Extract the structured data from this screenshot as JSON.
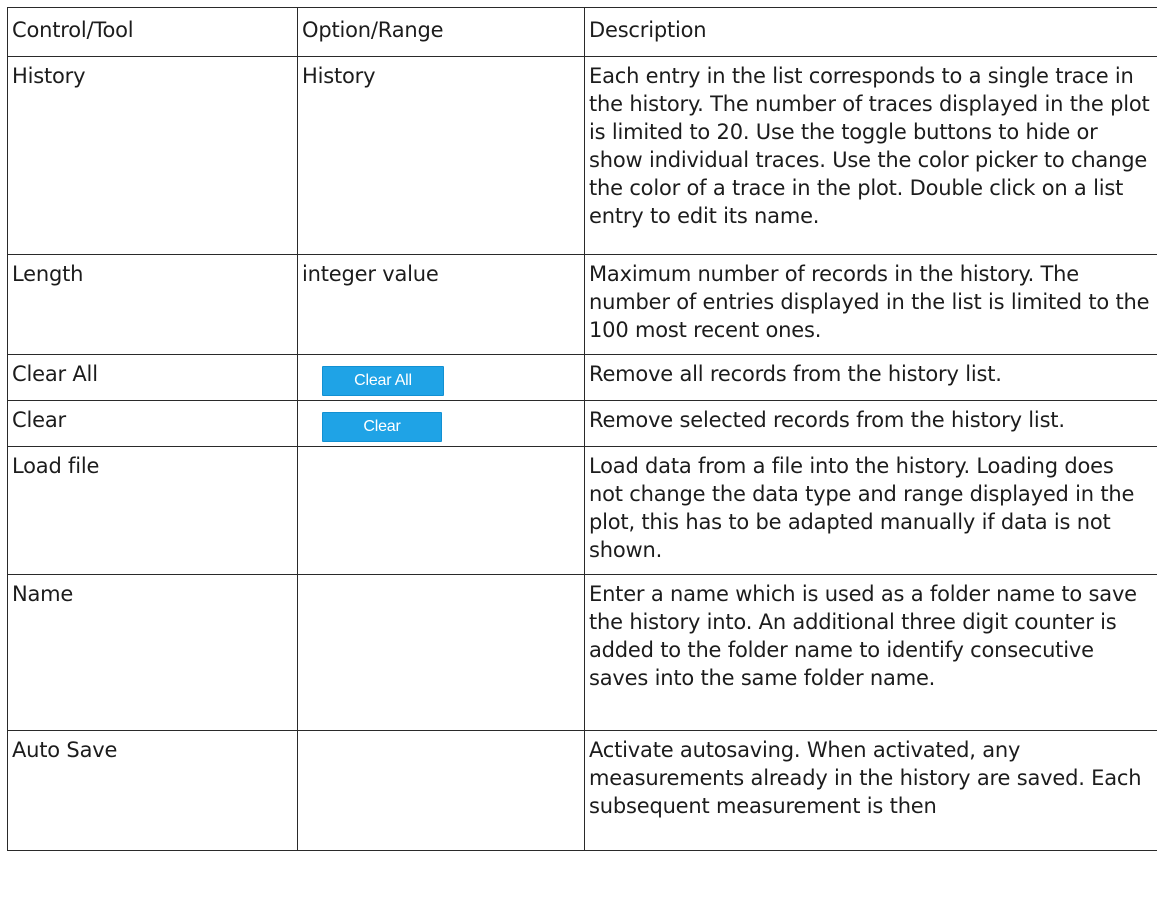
{
  "header": {
    "col1": "Control/Tool",
    "col2": "Option/Range",
    "col3": "Description"
  },
  "rows": [
    {
      "control": "History",
      "option": "History",
      "description": "Each entry in the list corresponds to a single trace in the history. The number of traces displayed in the plot is limited to 20. Use the toggle buttons to hide or show individual traces. Use the color picker to change the color of a trace in the plot. Double click on a list entry to edit its name."
    },
    {
      "control": "Length",
      "option": "integer value",
      "description": "Maximum number of records in the history. The number of entries displayed in the list is limited to the 100 most recent ones."
    },
    {
      "control": "Clear All",
      "button_label": "Clear All",
      "description": "Remove all records from the history list."
    },
    {
      "control": "Clear",
      "button_label": "Clear",
      "description": "Remove selected records from the history list."
    },
    {
      "control": "Load file",
      "option": "",
      "description": "Load data from a file into the history. Loading does not change the data type and range displayed in the plot, this has to be adapted manually if data is not shown."
    },
    {
      "control": "Name",
      "option": "",
      "description": "Enter a name which is used as a folder name to save the history into. An additional three digit counter is added to the folder name to identify consecutive saves into the same folder name."
    },
    {
      "control": "Auto Save",
      "option": "",
      "description": "Activate autosaving. When activated, any measurements already in the history are saved. Each subsequent measurement is then"
    }
  ],
  "colors": {
    "button_bg": "#1fa3e6",
    "button_text": "#ffffff",
    "border": "#2a2a2a"
  }
}
